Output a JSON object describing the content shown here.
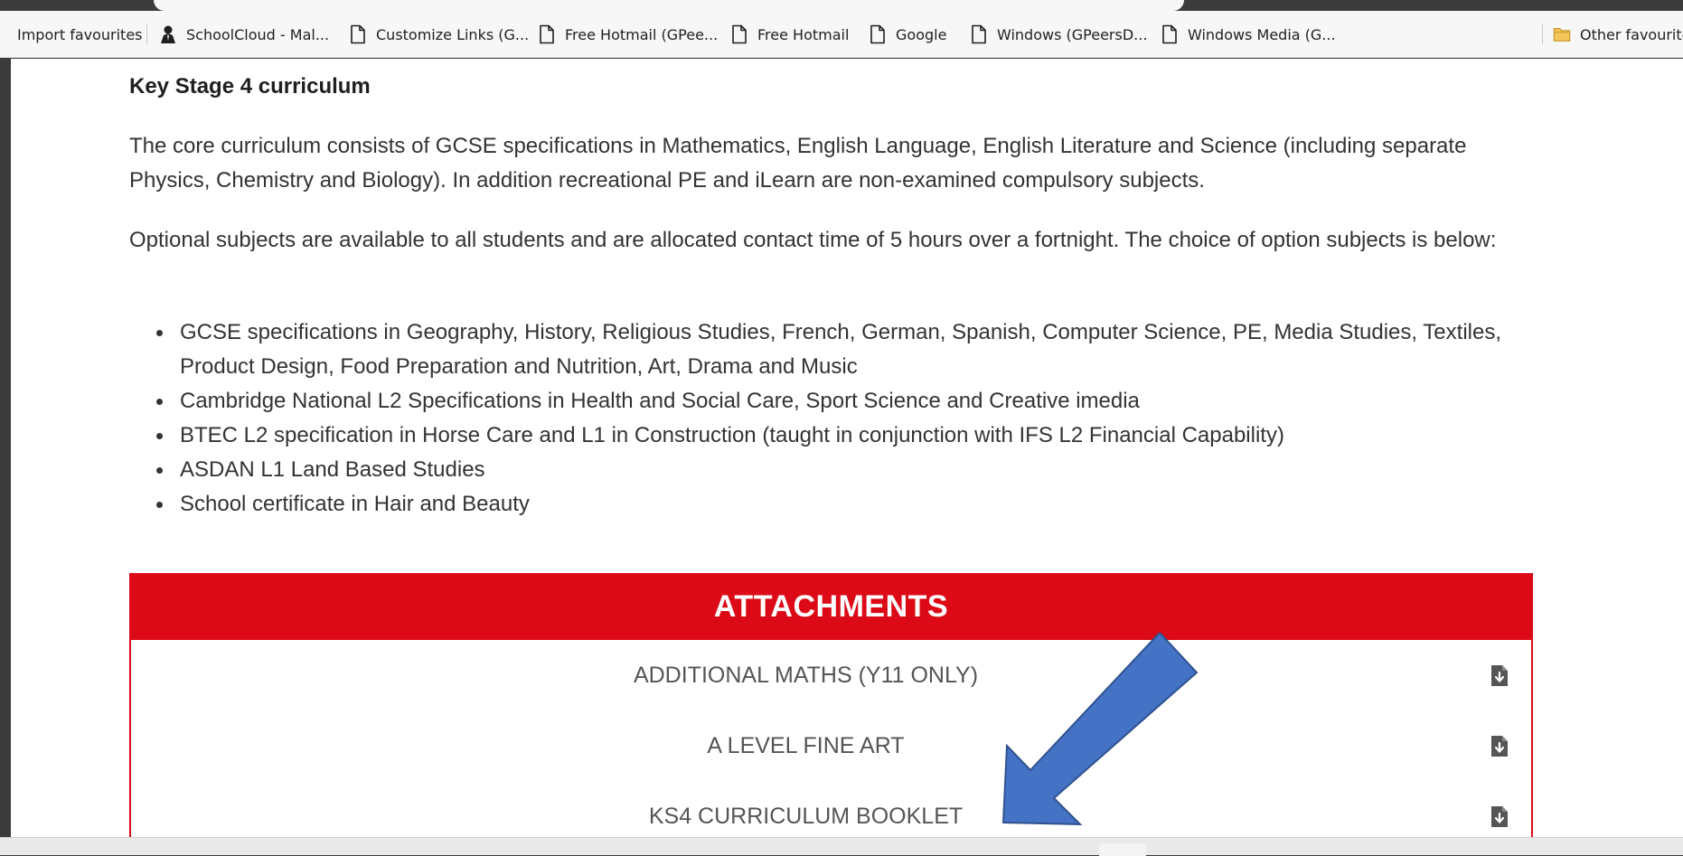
{
  "bookmarks": [
    {
      "label": "Import favourites",
      "icon": "none"
    },
    {
      "label": "SchoolCloud - Mal...",
      "icon": "person-icon"
    },
    {
      "label": "Customize Links (G...",
      "icon": "page-icon"
    },
    {
      "label": "Free Hotmail (GPee...",
      "icon": "page-icon"
    },
    {
      "label": "Free Hotmail",
      "icon": "page-icon"
    },
    {
      "label": "Google",
      "icon": "page-icon"
    },
    {
      "label": "Windows (GPeersD...",
      "icon": "page-icon"
    },
    {
      "label": "Windows Media (G...",
      "icon": "page-icon"
    },
    {
      "label": "Other favourites",
      "icon": "folder-icon"
    }
  ],
  "content": {
    "heading": "Key Stage 4 curriculum",
    "paragraph1": "The core curriculum consists of GCSE specifications in Mathematics, English Language, English Literature and Science (including separate Physics, Chemistry and Biology). In addition recreational PE and iLearn are non-examined compulsory subjects.",
    "paragraph2": "Optional subjects are available to all students and are allocated contact time of 5 hours over a fortnight. The choice of option subjects is below:",
    "options": [
      "GCSE specifications in Geography, History, Religious Studies, French, German, Spanish, Computer Science, PE, Media Studies, Textiles, Product Design, Food Preparation and Nutrition, Art, Drama and Music",
      "Cambridge National L2 Specifications in Health and Social Care, Sport Science and Creative imedia",
      "BTEC L2 specification in Horse Care and L1 in Construction (taught in conjunction with IFS L2 Financial Capability)",
      "ASDAN L1 Land Based Studies",
      "School certificate in Hair and Beauty"
    ]
  },
  "attachments": {
    "title": "ATTACHMENTS",
    "items": [
      {
        "label": "ADDITIONAL MATHS (Y11 ONLY)",
        "icon": "download-file-icon"
      },
      {
        "label": "A LEVEL FINE ART",
        "icon": "download-file-icon"
      },
      {
        "label": "KS4 CURRICULUM BOOKLET",
        "icon": "download-file-icon"
      }
    ]
  },
  "colors": {
    "attachments_red": "#dc0a17",
    "arrow_blue": "#4472c4",
    "arrow_outline": "#2f528f"
  }
}
